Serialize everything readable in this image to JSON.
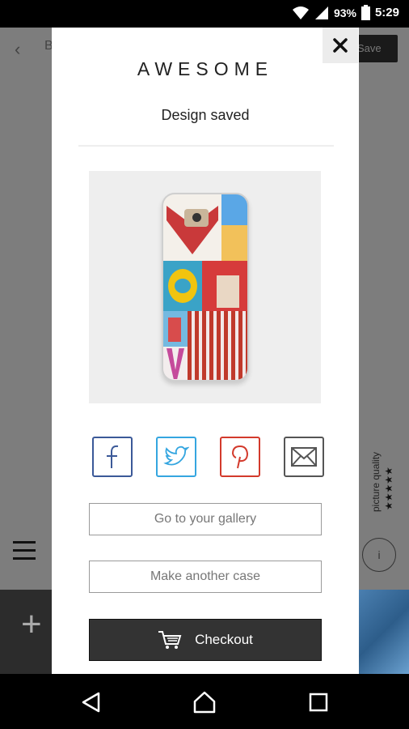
{
  "status_bar": {
    "battery": "93%",
    "time": "5:29"
  },
  "background": {
    "title_fragment": "B",
    "save_label": "Save",
    "picture_quality_label": "picture quality",
    "stars": "★★★★★",
    "info_label": "i",
    "add_label": "+"
  },
  "modal": {
    "brand": "AWESOME",
    "status_message": "Design saved",
    "close_label": "✕",
    "share": [
      "facebook-icon",
      "twitter-icon",
      "pinterest-icon",
      "email-icon"
    ],
    "gallery_button": "Go to your gallery",
    "another_button": "Make another case",
    "checkout_button": "Checkout"
  },
  "colors": {
    "facebook": "#3b5998",
    "twitter": "#35a6e0",
    "pinterest": "#d33a2c",
    "email": "#555555",
    "checkout_bg": "#333333"
  }
}
